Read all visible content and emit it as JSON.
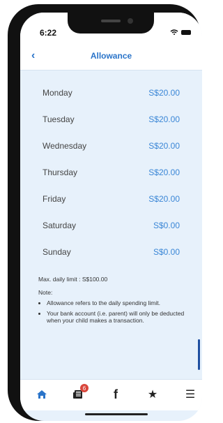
{
  "status": {
    "time": "6:22"
  },
  "header": {
    "back_icon": "chevron-left-icon",
    "title": "Allowance"
  },
  "allowances": [
    {
      "day": "Monday",
      "amount": "S$20.00"
    },
    {
      "day": "Tuesday",
      "amount": "S$20.00"
    },
    {
      "day": "Wednesday",
      "amount": "S$20.00"
    },
    {
      "day": "Thursday",
      "amount": "S$20.00"
    },
    {
      "day": "Friday",
      "amount": "S$20.00"
    },
    {
      "day": "Saturday",
      "amount": "S$0.00"
    },
    {
      "day": "Sunday",
      "amount": "S$0.00"
    }
  ],
  "info": {
    "max_limit": "Max. daily limit : S$100.00",
    "note_label": "Note:",
    "notes": [
      "Allowance refers to the daily spending limit.",
      "Your bank account (i.e. parent) will only be deducted when your child makes a transaction."
    ]
  },
  "tabbar": {
    "items": [
      {
        "icon": "home-icon",
        "active": true
      },
      {
        "icon": "news-icon",
        "badge": "6"
      },
      {
        "icon": "facebook-icon",
        "glyph": "f"
      },
      {
        "icon": "star-icon",
        "glyph": "★"
      },
      {
        "icon": "menu-icon",
        "glyph": "☰"
      }
    ]
  },
  "colors": {
    "accent": "#2a74c9",
    "amount": "#3a86d6",
    "background": "#e7f1fb",
    "badge": "#d9463b"
  }
}
